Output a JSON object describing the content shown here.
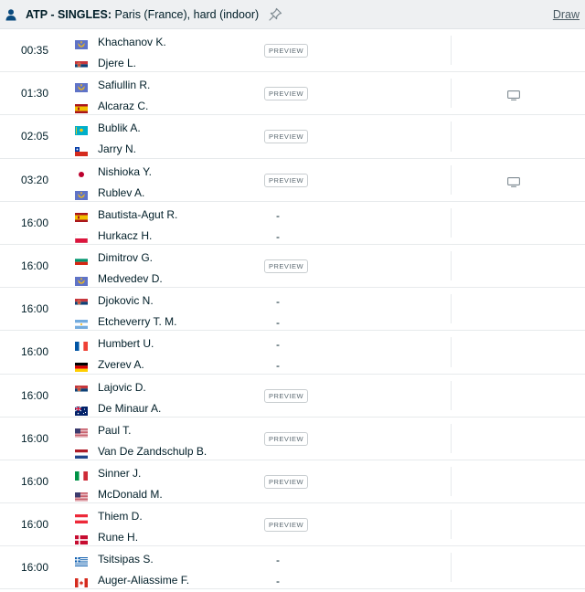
{
  "header": {
    "category": "ATP - SINGLES:",
    "tournament": "Paris (France), hard (indoor)",
    "draw_label": "Draw",
    "person_icon": "person-icon",
    "pin_icon": "pin-icon"
  },
  "preview_label": "PREVIEW",
  "dash": "-",
  "matches": [
    {
      "time": "00:35",
      "p1": "Khachanov K.",
      "f1": "neutral",
      "p2": "Djere L.",
      "f2": "serbia",
      "status": "preview",
      "tv": false
    },
    {
      "time": "01:30",
      "p1": "Safiullin R.",
      "f1": "neutral",
      "p2": "Alcaraz C.",
      "f2": "spain",
      "status": "preview",
      "tv": true
    },
    {
      "time": "02:05",
      "p1": "Bublik A.",
      "f1": "kazakhstan",
      "p2": "Jarry N.",
      "f2": "chile",
      "status": "preview",
      "tv": false
    },
    {
      "time": "03:20",
      "p1": "Nishioka Y.",
      "f1": "japan",
      "p2": "Rublev A.",
      "f2": "neutral",
      "status": "preview",
      "tv": true
    },
    {
      "time": "16:00",
      "p1": "Bautista-Agut R.",
      "f1": "spain",
      "p2": "Hurkacz H.",
      "f2": "poland",
      "status": "dash",
      "tv": false
    },
    {
      "time": "16:00",
      "p1": "Dimitrov G.",
      "f1": "bulgaria",
      "p2": "Medvedev D.",
      "f2": "neutral",
      "status": "preview",
      "tv": false
    },
    {
      "time": "16:00",
      "p1": "Djokovic N.",
      "f1": "serbia",
      "p2": "Etcheverry T. M.",
      "f2": "argentina",
      "status": "dash",
      "tv": false
    },
    {
      "time": "16:00",
      "p1": "Humbert U.",
      "f1": "france",
      "p2": "Zverev A.",
      "f2": "germany",
      "status": "dash",
      "tv": false
    },
    {
      "time": "16:00",
      "p1": "Lajovic D.",
      "f1": "serbia",
      "p2": "De Minaur A.",
      "f2": "australia",
      "status": "preview",
      "tv": false
    },
    {
      "time": "16:00",
      "p1": "Paul T.",
      "f1": "usa",
      "p2": "Van De Zandschulp B.",
      "f2": "netherlands",
      "status": "preview",
      "tv": false
    },
    {
      "time": "16:00",
      "p1": "Sinner J.",
      "f1": "italy",
      "p2": "McDonald M.",
      "f2": "usa",
      "status": "preview",
      "tv": false
    },
    {
      "time": "16:00",
      "p1": "Thiem D.",
      "f1": "austria",
      "p2": "Rune H.",
      "f2": "denmark",
      "status": "preview",
      "tv": false
    },
    {
      "time": "16:00",
      "p1": "Tsitsipas S.",
      "f1": "greece",
      "p2": "Auger-Aliassime F.",
      "f2": "canada",
      "status": "dash",
      "tv": false
    }
  ]
}
